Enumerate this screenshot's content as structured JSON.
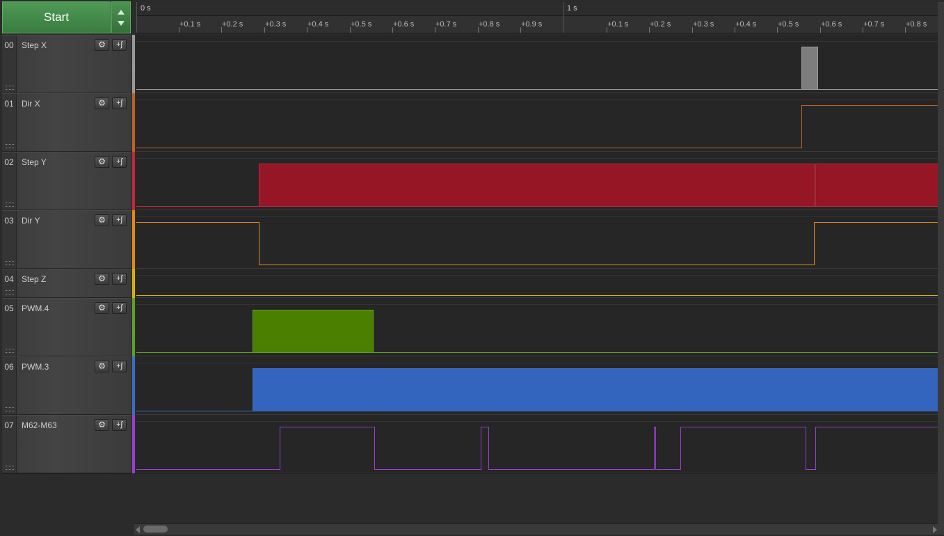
{
  "start_button": {
    "label": "Start"
  },
  "ruler": {
    "major_labels": [
      "0 s",
      "1 s"
    ],
    "tick_labels": [
      "+0.1 s",
      "+0.2 s",
      "+0.3 s",
      "+0.4 s",
      "+0.5 s",
      "+0.6 s",
      "+0.7 s",
      "+0.8 s",
      "+0.9 s",
      "+0.1 s",
      "+0.2 s",
      "+0.3 s",
      "+0.4 s",
      "+0.5 s",
      "+0.6 s",
      "+0.7 s",
      "+0.8 s"
    ]
  },
  "time_window": {
    "start_s": 0,
    "end_s": 1.875
  },
  "channels": [
    {
      "index": "00",
      "name": "Step X",
      "color": "#9a9a9a",
      "fill": "#7d7d7d",
      "kind": "dense",
      "initial": 0,
      "bursts": [
        [
          1.556,
          1.593
        ]
      ]
    },
    {
      "index": "01",
      "name": "Dir X",
      "color": "#b8642a",
      "kind": "digital",
      "initial": 0,
      "edges": [
        1.556
      ]
    },
    {
      "index": "02",
      "name": "Step Y",
      "color": "#c0283a",
      "fill": "#961626",
      "kind": "dense",
      "initial": 0,
      "bursts": [
        [
          0.286,
          1.585
        ],
        [
          1.588,
          1.875
        ]
      ]
    },
    {
      "index": "03",
      "name": "Dir Y",
      "color": "#e08a14",
      "kind": "digital",
      "initial": 1,
      "edges": [
        0.286,
        1.585
      ]
    },
    {
      "index": "04",
      "name": "Step Z",
      "color": "#d8b400",
      "kind": "digital",
      "initial": 0,
      "edges": []
    },
    {
      "index": "05",
      "name": "PWM.4",
      "color": "#5fa02a",
      "fill": "#4a7f00",
      "kind": "dense",
      "initial": 0,
      "bursts": [
        [
          0.272,
          0.554
        ]
      ]
    },
    {
      "index": "06",
      "name": "PWM.3",
      "color": "#3a6ec8",
      "fill": "#3465be",
      "kind": "dense",
      "initial": 0,
      "bursts": [
        [
          0.272,
          1.875
        ]
      ]
    },
    {
      "index": "07",
      "name": "M62-M63",
      "color": "#9a3fd0",
      "kind": "digital",
      "initial": 0,
      "edges": [
        0.336,
        0.556,
        0.805,
        0.824,
        1.211,
        1.215,
        1.273,
        1.565,
        1.589
      ]
    }
  ],
  "icons": {
    "gear": "gear-icon",
    "trigger": "trigger-icon",
    "grip": "grip-icon"
  }
}
